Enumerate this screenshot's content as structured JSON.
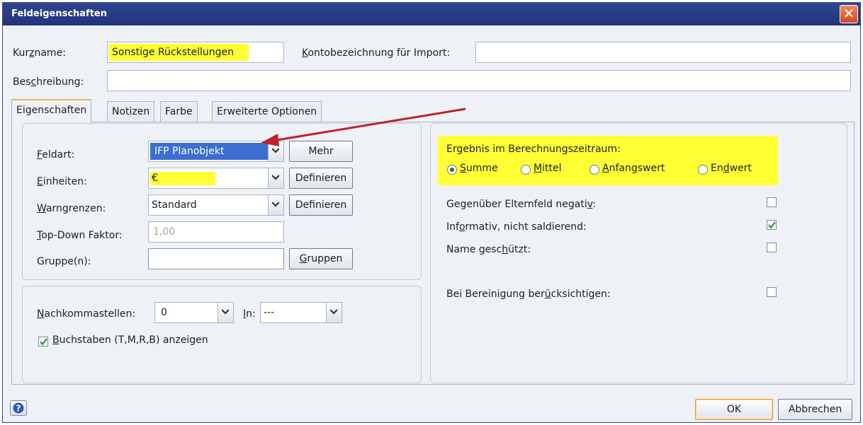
{
  "window": {
    "title": "Feldeigenschaften",
    "close_glyph": "✕"
  },
  "header": {
    "kurzname_label": "Kurzname:",
    "kurzname_value": "Sonstige Rückstellungen",
    "konto_label": "Kontobezeichnung für Import:",
    "konto_value": "",
    "beschreibung_label": "Beschreibung:",
    "beschreibung_value": ""
  },
  "tabs": [
    "Eigenschaften",
    "Notizen",
    "Farbe",
    "Erweiterte Optionen"
  ],
  "props": {
    "feldart_label": "Feldart:",
    "feldart_value": "IFP Planobjekt",
    "mehr_button": "Mehr",
    "einheiten_label": "Einheiten:",
    "einheiten_value": "€",
    "definieren_button": "Definieren",
    "warngrenzen_label": "Warngrenzen:",
    "warngrenzen_value": "Standard",
    "definieren_button2": "Definieren",
    "topdown_label": "Top-Down Faktor:",
    "topdown_value": "1,00",
    "gruppe_label": "Gruppe(n):",
    "gruppe_value": "",
    "gruppen_button": "Gruppen"
  },
  "format": {
    "nachkomma_label": "Nachkommastellen:",
    "nachkomma_value": "0",
    "in_label": "In:",
    "in_value": "---",
    "buchstaben_label": "Buchstaben (T,M,R,B) anzeigen",
    "buchstaben_checked": true
  },
  "result": {
    "title": "Ergebnis im Berechnungszeitraum:",
    "options": [
      "Summe",
      "Mittel",
      "Anfangswert",
      "Endwert"
    ],
    "selected": "Summe"
  },
  "options": {
    "negativ_label": "Gegenüber Elternfeld negativ:",
    "negativ_checked": false,
    "informativ_label": "Informativ, nicht saldierend:",
    "informativ_checked": true,
    "geschuetzt_label": "Name geschützt:",
    "geschuetzt_checked": false,
    "bereinigung_label": "Bei Bereinigung berücksichtigen:",
    "bereinigung_checked": false
  },
  "footer": {
    "help_icon": "question-icon",
    "ok_button": "OK",
    "cancel_button": "Abbrechen"
  },
  "colors": {
    "highlight": "#ffff33",
    "arrow": "#c0202a",
    "title_bar": "#2f4590"
  }
}
